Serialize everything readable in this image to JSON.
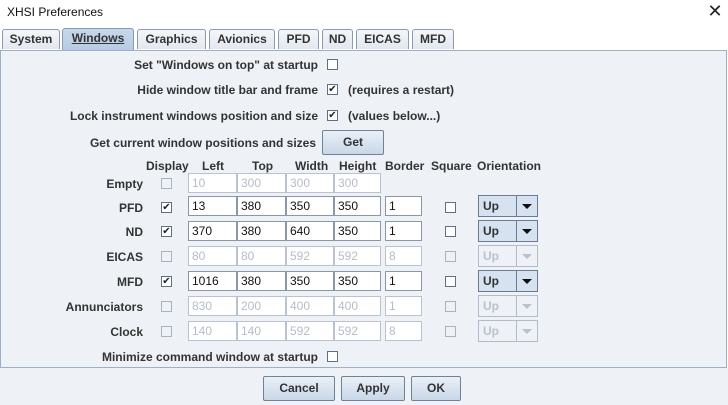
{
  "window": {
    "title": "XHSI Preferences"
  },
  "tabs": [
    {
      "label": "System"
    },
    {
      "label": "Windows"
    },
    {
      "label": "Graphics"
    },
    {
      "label": "Avionics"
    },
    {
      "label": "PFD"
    },
    {
      "label": "ND"
    },
    {
      "label": "EICAS"
    },
    {
      "label": "MFD"
    }
  ],
  "active_tab": "Windows",
  "options": {
    "windows_on_top": {
      "label": "Set \"Windows on top\" at startup",
      "checked": false
    },
    "hide_title_bar": {
      "label": "Hide window title bar and frame",
      "checked": true,
      "note": "(requires a restart)"
    },
    "lock_position": {
      "label": "Lock instrument windows position and size",
      "checked": true,
      "note": "(values below...)"
    },
    "get_positions": {
      "label": "Get current window positions and sizes",
      "button": "Get"
    },
    "minimize_cmd": {
      "label": "Minimize command window at startup",
      "checked": false
    }
  },
  "table": {
    "headers": {
      "display": "Display",
      "left": "Left",
      "top": "Top",
      "width": "Width",
      "height": "Height",
      "border": "Border",
      "square": "Square",
      "orientation": "Orientation"
    },
    "rows": [
      {
        "name": "Empty",
        "display": false,
        "left": "10",
        "top": "300",
        "width": "300",
        "height": "300",
        "border": null,
        "square": null,
        "orientation": null,
        "enabled": false
      },
      {
        "name": "PFD",
        "display": true,
        "left": "13",
        "top": "380",
        "width": "350",
        "height": "350",
        "border": "1",
        "square": false,
        "orientation": "Up",
        "enabled": true
      },
      {
        "name": "ND",
        "display": true,
        "left": "370",
        "top": "380",
        "width": "640",
        "height": "350",
        "border": "1",
        "square": false,
        "orientation": "Up",
        "enabled": true
      },
      {
        "name": "EICAS",
        "display": false,
        "left": "80",
        "top": "80",
        "width": "592",
        "height": "592",
        "border": "8",
        "square": false,
        "orientation": "Up",
        "enabled": false
      },
      {
        "name": "MFD",
        "display": true,
        "left": "1016",
        "top": "380",
        "width": "350",
        "height": "350",
        "border": "1",
        "square": false,
        "orientation": "Up",
        "enabled": true
      },
      {
        "name": "Annunciators",
        "display": false,
        "left": "830",
        "top": "200",
        "width": "400",
        "height": "400",
        "border": "1",
        "square": false,
        "orientation": "Up",
        "enabled": false
      },
      {
        "name": "Clock",
        "display": false,
        "left": "140",
        "top": "140",
        "width": "592",
        "height": "592",
        "border": "8",
        "square": false,
        "orientation": "Up",
        "enabled": false
      }
    ]
  },
  "footer": {
    "cancel": "Cancel",
    "apply": "Apply",
    "ok": "OK"
  },
  "icons": {
    "close": "close-icon",
    "combo_arrow": "chevron-down-icon"
  },
  "colors": {
    "panel_bg": "#eef1f6",
    "tab_active": "#c8d8ea",
    "button_bg": "#c9d7e7"
  }
}
